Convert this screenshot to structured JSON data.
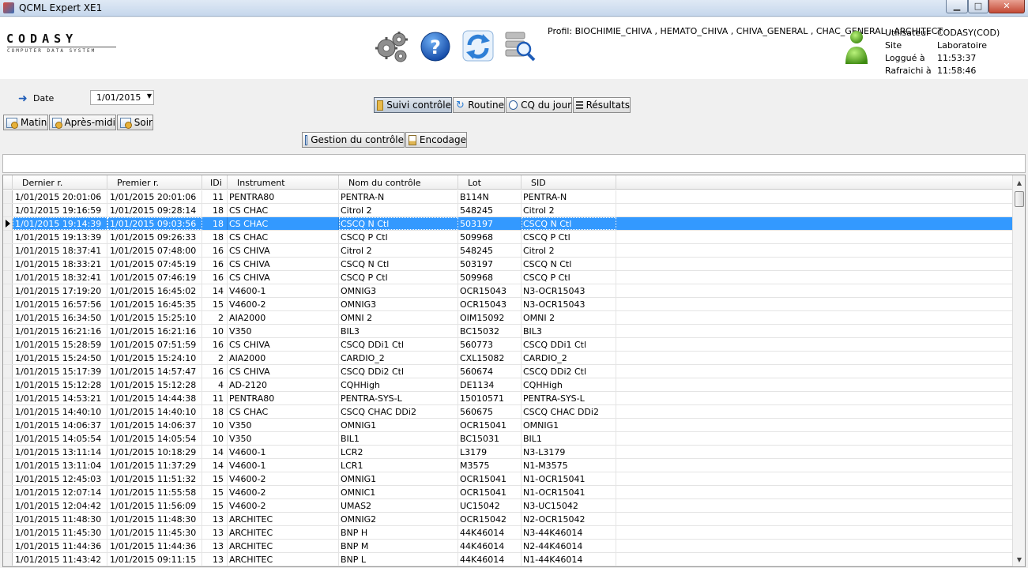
{
  "window": {
    "title": "QCML Expert XE1",
    "controls": {
      "minimize": "▁",
      "maximize": "□",
      "close": "✕"
    }
  },
  "header": {
    "logo_text": "CODASY",
    "logo_subtitle": "COMPUTER DATA SYSTEM",
    "toolbar_icons": [
      "settings-gears-icon",
      "help-icon",
      "refresh-icon",
      "search-database-icon"
    ],
    "profil": "Profil:  BIOCHIMIE_CHIVA , HEMATO_CHIVA , CHIVA_GENERAL , CHAC_GENERAL , ARCHITECT",
    "user_info": [
      {
        "key": "Utilisateur",
        "value": "CODASY(COD)"
      },
      {
        "key": "Site",
        "value": "Laboratoire"
      },
      {
        "key": "Loggué à",
        "value": "11:53:37"
      },
      {
        "key": "Rafraichi à",
        "value": "11:58:46"
      }
    ]
  },
  "date_filter": {
    "label": "Date",
    "value": "1/01/2015"
  },
  "period_buttons": [
    "Matin",
    "Après-midi",
    "Soir"
  ],
  "view_tabs": [
    "Suivi contrôle",
    "Routine",
    "CQ du jour",
    "Résultats"
  ],
  "secondary_buttons": [
    "Gestion du contrôle",
    "Encodage"
  ],
  "table": {
    "columns": [
      "Dernier r.",
      "Premier r.",
      "IDi",
      "Instrument",
      "Nom du contrôle",
      "Lot",
      "SID"
    ],
    "selected_row": 2,
    "rows": [
      [
        "1/01/2015 20:01:06",
        "1/01/2015 20:01:06",
        "11",
        "PENTRA80",
        "PENTRA-N",
        "B114N",
        "PENTRA-N"
      ],
      [
        "1/01/2015 19:16:59",
        "1/01/2015 09:28:14",
        "18",
        "CS CHAC",
        "Citrol 2",
        "548245",
        "Citrol 2"
      ],
      [
        "1/01/2015 19:14:39",
        "1/01/2015 09:03:56",
        "18",
        "CS CHAC",
        "CSCQ N Ctl",
        "503197",
        "CSCQ N Ctl"
      ],
      [
        "1/01/2015 19:13:39",
        "1/01/2015 09:26:33",
        "18",
        "CS CHAC",
        "CSCQ P Ctl",
        "509968",
        "CSCQ P Ctl"
      ],
      [
        "1/01/2015 18:37:41",
        "1/01/2015 07:48:00",
        "16",
        "CS CHIVA",
        "Citrol 2",
        "548245",
        "Citrol 2"
      ],
      [
        "1/01/2015 18:33:21",
        "1/01/2015 07:45:19",
        "16",
        "CS CHIVA",
        "CSCQ N Ctl",
        "503197",
        "CSCQ N Ctl"
      ],
      [
        "1/01/2015 18:32:41",
        "1/01/2015 07:46:19",
        "16",
        "CS CHIVA",
        "CSCQ P Ctl",
        "509968",
        "CSCQ P Ctl"
      ],
      [
        "1/01/2015 17:19:20",
        "1/01/2015 16:45:02",
        "14",
        "V4600-1",
        "OMNIG3",
        "OCR15043",
        "N3-OCR15043"
      ],
      [
        "1/01/2015 16:57:56",
        "1/01/2015 16:45:35",
        "15",
        "V4600-2",
        "OMNIG3",
        "OCR15043",
        "N3-OCR15043"
      ],
      [
        "1/01/2015 16:34:50",
        "1/01/2015 15:25:10",
        "2",
        "AIA2000",
        "OMNI 2",
        "OIM15092",
        "OMNI 2"
      ],
      [
        "1/01/2015 16:21:16",
        "1/01/2015 16:21:16",
        "10",
        "V350",
        "BIL3",
        "BC15032",
        "BIL3"
      ],
      [
        "1/01/2015 15:28:59",
        "1/01/2015 07:51:59",
        "16",
        "CS CHIVA",
        "CSCQ DDi1 Ctl",
        "560773",
        "CSCQ DDi1 Ctl"
      ],
      [
        "1/01/2015 15:24:50",
        "1/01/2015 15:24:10",
        "2",
        "AIA2000",
        "CARDIO_2",
        "CXL15082",
        "CARDIO_2"
      ],
      [
        "1/01/2015 15:17:39",
        "1/01/2015 14:57:47",
        "16",
        "CS CHIVA",
        "CSCQ DDi2 Ctl",
        "560674",
        "CSCQ DDi2 Ctl"
      ],
      [
        "1/01/2015 15:12:28",
        "1/01/2015 15:12:28",
        "4",
        "AD-2120",
        "CQHHigh",
        "DE1134",
        "CQHHigh"
      ],
      [
        "1/01/2015 14:53:21",
        "1/01/2015 14:44:38",
        "11",
        "PENTRA80",
        "PENTRA-SYS-L",
        "15010571",
        "PENTRA-SYS-L"
      ],
      [
        "1/01/2015 14:40:10",
        "1/01/2015 14:40:10",
        "18",
        "CS CHAC",
        "CSCQ CHAC DDi2",
        "560675",
        "CSCQ CHAC DDi2"
      ],
      [
        "1/01/2015 14:06:37",
        "1/01/2015 14:06:37",
        "10",
        "V350",
        "OMNIG1",
        "OCR15041",
        "OMNIG1"
      ],
      [
        "1/01/2015 14:05:54",
        "1/01/2015 14:05:54",
        "10",
        "V350",
        "BIL1",
        "BC15031",
        "BIL1"
      ],
      [
        "1/01/2015 13:11:14",
        "1/01/2015 10:18:29",
        "14",
        "V4600-1",
        "LCR2",
        "L3179",
        "N3-L3179"
      ],
      [
        "1/01/2015 13:11:04",
        "1/01/2015 11:37:29",
        "14",
        "V4600-1",
        "LCR1",
        "M3575",
        "N1-M3575"
      ],
      [
        "1/01/2015 12:45:03",
        "1/01/2015 11:51:32",
        "15",
        "V4600-2",
        "OMNIG1",
        "OCR15041",
        "N1-OCR15041"
      ],
      [
        "1/01/2015 12:07:14",
        "1/01/2015 11:55:58",
        "15",
        "V4600-2",
        "OMNIC1",
        "OCR15041",
        "N1-OCR15041"
      ],
      [
        "1/01/2015 12:04:42",
        "1/01/2015 11:56:09",
        "15",
        "V4600-2",
        "UMAS2",
        "UC15042",
        "N3-UC15042"
      ],
      [
        "1/01/2015 11:48:30",
        "1/01/2015 11:48:30",
        "13",
        "ARCHITEC",
        "OMNIG2",
        "OCR15042",
        "N2-OCR15042"
      ],
      [
        "1/01/2015 11:45:30",
        "1/01/2015 11:45:30",
        "13",
        "ARCHITEC",
        "BNP H",
        "44K46014",
        "N3-44K46014"
      ],
      [
        "1/01/2015 11:44:36",
        "1/01/2015 11:44:36",
        "13",
        "ARCHITEC",
        "BNP M",
        "44K46014",
        "N2-44K46014"
      ],
      [
        "1/01/2015 11:43:42",
        "1/01/2015 09:11:15",
        "13",
        "ARCHITEC",
        "BNP L",
        "44K46014",
        "N1-44K46014"
      ]
    ]
  }
}
